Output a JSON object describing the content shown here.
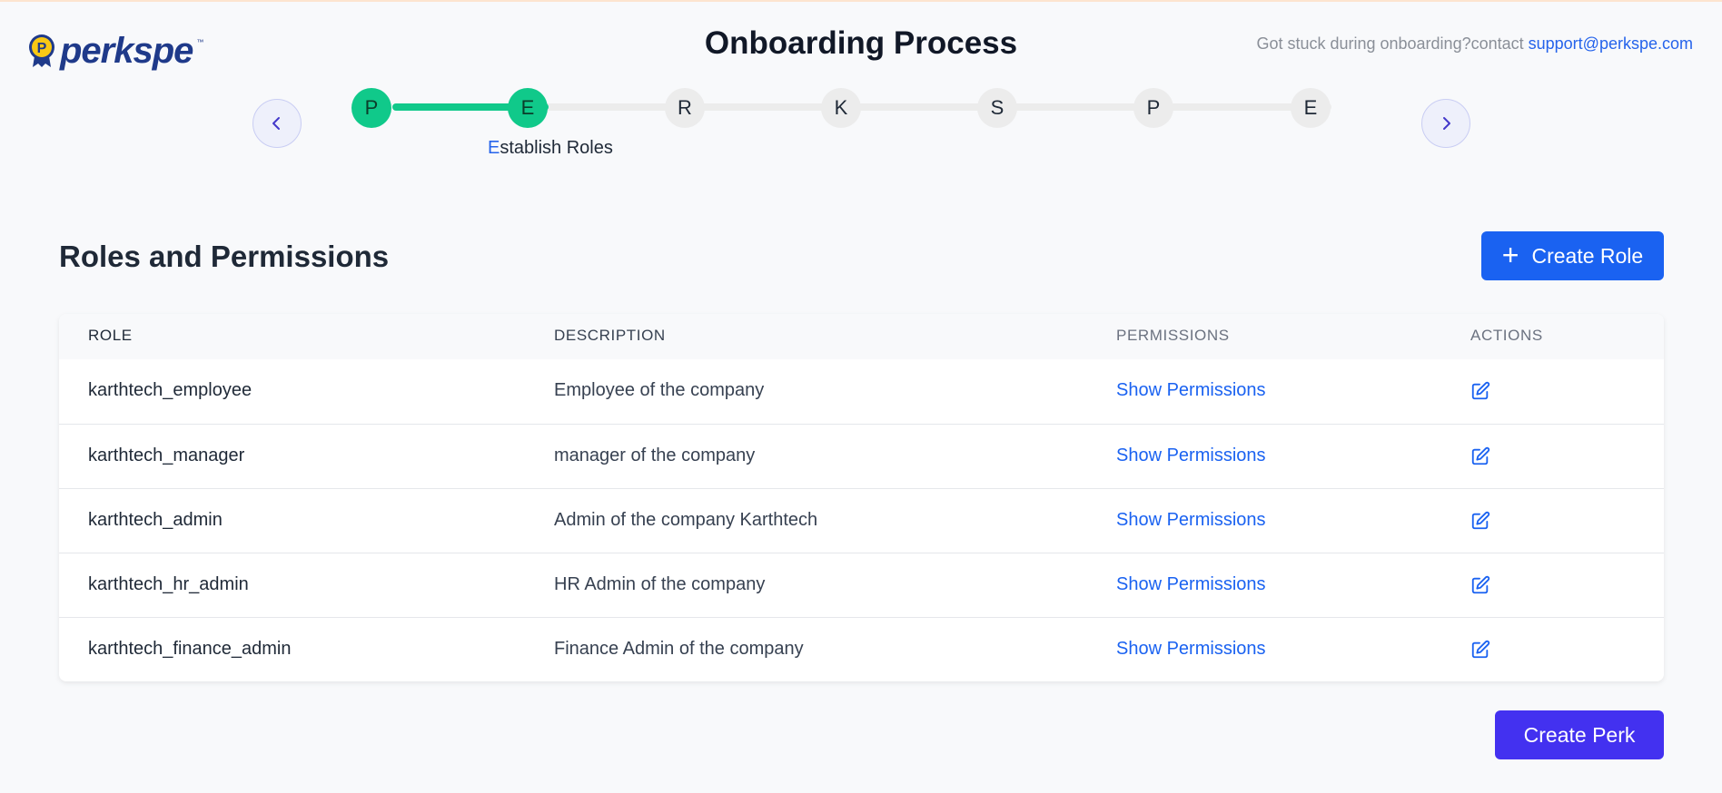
{
  "header": {
    "logo_text": "perkspe",
    "logo_tm": "™",
    "title": "Onboarding Process",
    "support_prefix": "Got stuck during onboarding?contact ",
    "support_email": "support@perkspe.com"
  },
  "stepper": {
    "steps": [
      {
        "letter": "P",
        "done": true
      },
      {
        "letter": "E",
        "done": true
      },
      {
        "letter": "R",
        "done": false
      },
      {
        "letter": "K",
        "done": false
      },
      {
        "letter": "S",
        "done": false
      },
      {
        "letter": "P",
        "done": false
      },
      {
        "letter": "E",
        "done": false
      }
    ],
    "current_label_first": "E",
    "current_label_rest": "stablish Roles",
    "progress": 0.167
  },
  "section": {
    "title": "Roles and Permissions",
    "create_role_label": "Create Role"
  },
  "table": {
    "headers": {
      "role": "ROLE",
      "description": "DESCRIPTION",
      "permissions": "PERMISSIONS",
      "actions": "ACTIONS"
    },
    "rows": [
      {
        "role": "karthtech_employee",
        "description": "Employee of the company",
        "permissions": "Show Permissions"
      },
      {
        "role": "karthtech_manager",
        "description": "manager of the company",
        "permissions": "Show Permissions"
      },
      {
        "role": "karthtech_admin",
        "description": "Admin of the company Karthtech",
        "permissions": "Show Permissions"
      },
      {
        "role": "karthtech_hr_admin",
        "description": "HR Admin of the company",
        "permissions": "Show Permissions"
      },
      {
        "role": "karthtech_finance_admin",
        "description": "Finance Admin of the company",
        "permissions": "Show Permissions"
      }
    ]
  },
  "footer": {
    "create_perk_label": "Create Perk"
  },
  "colors": {
    "primary": "#1a62f1",
    "success": "#10c98a",
    "perk_button": "#4331f0"
  }
}
